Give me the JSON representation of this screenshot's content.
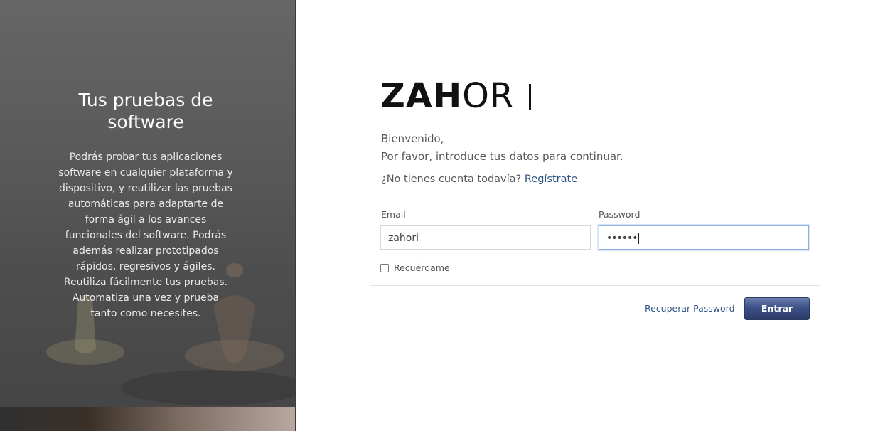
{
  "hero": {
    "title": "Tus pruebas de software",
    "text": "Podrás probar tus aplicaciones software en cualquier plataforma y dispositivo, y reutilizar las pruebas automáticas para adaptarte de forma ágil a los avances funcionales del software. Podrás además realizar prototipados rápidos, regresivos y ágiles. Reutiliza fácilmente tus pruebas. Automatiza una vez y prueba tanto como necesites."
  },
  "logo": {
    "bold": "ZAH",
    "thin": "OR"
  },
  "welcome": {
    "line1": "Bienvenido,",
    "line2": "Por favor, introduce tus datos para continuar."
  },
  "signup": {
    "prompt": "¿No tienes cuenta todavía?",
    "link": "Regístrate"
  },
  "form": {
    "email_label": "Email",
    "email_value": "zahori",
    "password_label": "Password",
    "password_value": "••••••",
    "remember_label": "Recuérdame",
    "remember_checked": false
  },
  "actions": {
    "recover_label": "Recuperar Password",
    "submit_label": "Entrar"
  },
  "colors": {
    "link": "#2f5588",
    "button": "#3e5187",
    "focus": "#8db2e8"
  }
}
